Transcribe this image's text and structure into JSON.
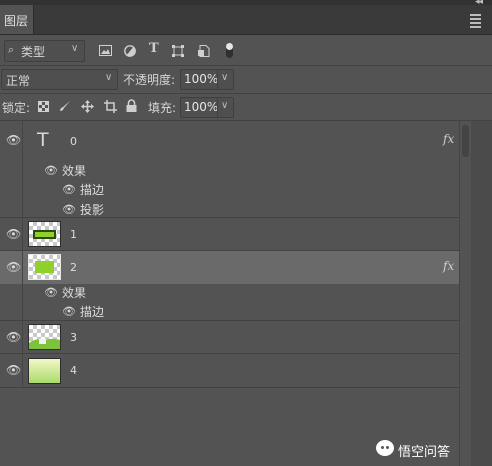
{
  "panel": {
    "tab_label": "图层",
    "collapse_glyph": "◂◂",
    "menu_icon": "menu-lines-icon"
  },
  "filter": {
    "search_glyph": "⌕",
    "label": "类型",
    "chevron": "∨",
    "icons": [
      "image-filter-icon",
      "adjustment-filter-icon",
      "type-filter-icon",
      "shape-filter-icon",
      "smart-object-filter-icon"
    ],
    "text_glyph": "T"
  },
  "blend": {
    "mode": "正常",
    "chevron": "∨",
    "opacity_label": "不透明度:",
    "opacity_value": "100%",
    "opacity_chevron": "∨"
  },
  "lock": {
    "label": "锁定:",
    "icons": [
      "lock-transparent-pixels-icon",
      "lock-image-pixels-icon",
      "lock-position-icon",
      "lock-artboard-icon",
      "lock-all-icon"
    ],
    "fill_label": "填充:",
    "fill_value": "100%",
    "fill_chevron": "∨"
  },
  "eye_glyph": "👁",
  "fx_label": "fx",
  "fx_chevron": "^",
  "layers": [
    {
      "name": "0",
      "kind": "text",
      "thumb_glyph": "T",
      "selected": false,
      "effects_label": "效果",
      "effects": [
        "描边",
        "投影"
      ]
    },
    {
      "name": "1",
      "kind": "image",
      "selected": false
    },
    {
      "name": "2",
      "kind": "image",
      "selected": true,
      "effects_label": "效果",
      "effects": [
        "描边"
      ]
    },
    {
      "name": "3",
      "kind": "image",
      "selected": false
    },
    {
      "name": "4",
      "kind": "image",
      "selected": false
    }
  ],
  "watermark": {
    "text": "悟空问答"
  },
  "colors": {
    "panel": "#535353",
    "selected_row": "#6a6a6a",
    "tab_bar": "#3a3a3a",
    "green_accent": "#8fd12a"
  }
}
